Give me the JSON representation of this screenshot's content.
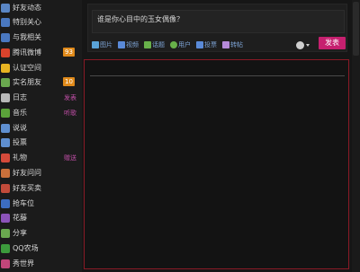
{
  "sidebar": {
    "items": [
      {
        "label": "好友动态",
        "icon": "friends-feed-icon",
        "color": "#5a86c5"
      },
      {
        "label": "特别关心",
        "icon": "special-care-icon",
        "color": "#4a78c0"
      },
      {
        "label": "与我相关",
        "icon": "related-to-me-icon",
        "color": "#4a78c0"
      },
      {
        "label": "腾讯微博",
        "icon": "tencent-weibo-icon",
        "color": "#d9432c",
        "badge": "93"
      },
      {
        "label": "认证空间",
        "icon": "certified-space-icon",
        "color": "#e8b422"
      },
      {
        "label": "实名朋友",
        "icon": "realname-friends-icon",
        "color": "#6aa84f",
        "badge": "10"
      },
      {
        "label": "日志",
        "icon": "blog-icon",
        "color": "#b8b8b8",
        "action": "发表"
      },
      {
        "label": "音乐",
        "icon": "music-icon",
        "color": "#5ba23a",
        "action": "听歌"
      },
      {
        "label": "说说",
        "icon": "shuoshuo-icon",
        "color": "#5f8fd0"
      },
      {
        "label": "投票",
        "icon": "vote-icon",
        "color": "#5f8fd0"
      },
      {
        "label": "礼物",
        "icon": "gift-icon",
        "color": "#d44a3a",
        "action": "赠送"
      },
      {
        "label": "好友问问",
        "icon": "friend-ask-icon",
        "color": "#c9703b"
      },
      {
        "label": "好友买卖",
        "icon": "friend-trade-icon",
        "color": "#c14b3a"
      },
      {
        "label": "抢车位",
        "icon": "parking-icon",
        "color": "#3c6cc0"
      },
      {
        "label": "花藤",
        "icon": "flower-vine-icon",
        "color": "#8b53b8"
      },
      {
        "label": "分享",
        "icon": "share-icon",
        "color": "#6aa84f"
      },
      {
        "label": "QQ农场",
        "icon": "qq-farm-icon",
        "color": "#3c9a3c"
      },
      {
        "label": "秀世界",
        "icon": "show-world-icon",
        "color": "#c1467a"
      }
    ]
  },
  "composer": {
    "input_value": "谁是你心目中的玉女偶像？",
    "tools": [
      {
        "label": "图片",
        "icon": "image-icon",
        "color": "#5aa3d8"
      },
      {
        "label": "视频",
        "icon": "video-icon",
        "color": "#5a8ad8"
      },
      {
        "label": "话题",
        "icon": "topic-icon",
        "color": "#68b04a"
      },
      {
        "label": "用户",
        "icon": "at-user-icon",
        "color": "#68b04a"
      },
      {
        "label": "投票",
        "icon": "poll-icon",
        "color": "#5a8ad8"
      },
      {
        "label": "转帖",
        "icon": "repost-icon",
        "color": "#b58ad8"
      }
    ],
    "publish_label": "发表"
  },
  "colors": {
    "badge": "#e08a1a",
    "publish": "#c6206f",
    "feed_border": "#8a1a26",
    "link": "#7fa6d8",
    "action": "#c24fa8"
  }
}
